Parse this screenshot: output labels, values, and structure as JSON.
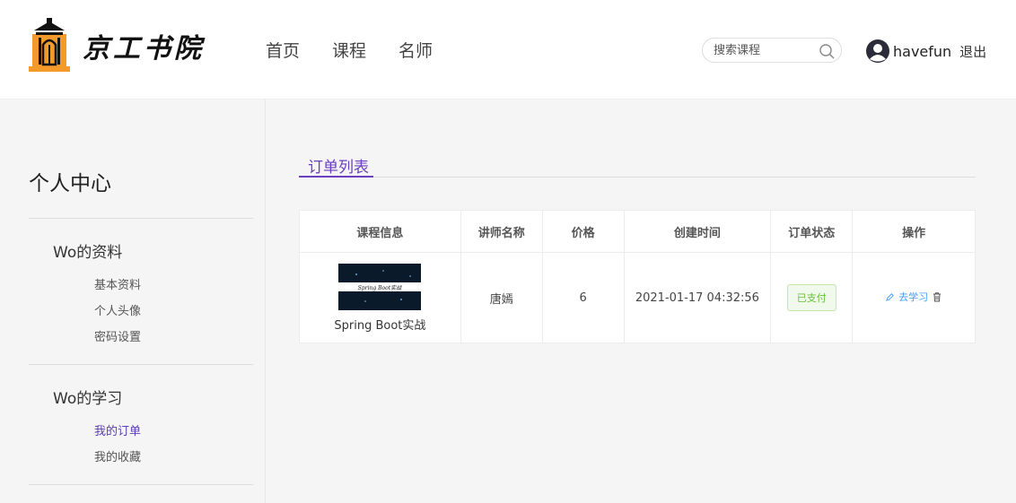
{
  "header": {
    "brand": "京工书院",
    "nav": [
      "首页",
      "课程",
      "名师"
    ],
    "search_placeholder": "搜索课程",
    "username": "havefun",
    "logout": "退出"
  },
  "sidebar": {
    "title": "个人中心",
    "groups": [
      {
        "label": "Wo的资料",
        "items": [
          "基本资料",
          "个人头像",
          "密码设置"
        ]
      },
      {
        "label": "Wo的学习",
        "items": [
          "我的订单",
          "我的收藏"
        ]
      }
    ],
    "active_item": "我的订单"
  },
  "main": {
    "tab": "订单列表",
    "columns": [
      "课程信息",
      "讲师名称",
      "价格",
      "创建时间",
      "订单状态",
      "操作"
    ],
    "rows": [
      {
        "cover_text": "Spring Boot实战",
        "course": "Spring Boot实战",
        "teacher": "唐嫣",
        "price": "6",
        "created": "2021-01-17 04:32:56",
        "status": "已支付",
        "action": "去学习"
      }
    ]
  },
  "colors": {
    "accent": "#6a3fc0",
    "link": "#409eff",
    "success": "#67c23a",
    "logo_orange": "#f39a2b"
  }
}
